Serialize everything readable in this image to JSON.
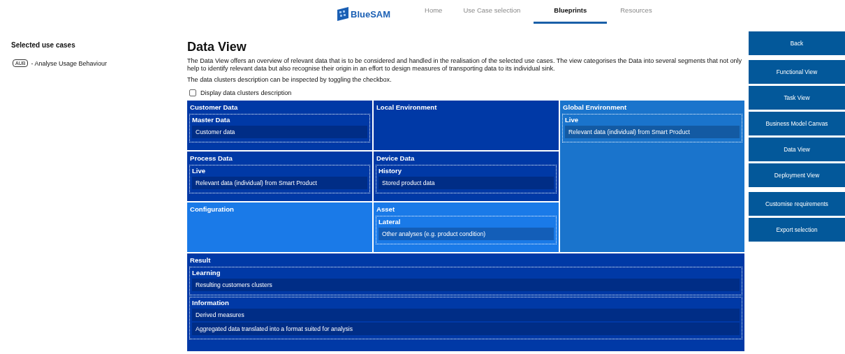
{
  "nav": {
    "logo": "BlueSAM",
    "tabs": [
      {
        "label": "Home",
        "selected": false
      },
      {
        "label": "Use Case selection",
        "selected": false
      },
      {
        "label": "Blueprints",
        "selected": true
      },
      {
        "label": "Resources",
        "selected": false
      }
    ]
  },
  "sidebar": {
    "title": "Selected use cases",
    "items": [
      {
        "badge": "AUB",
        "label": "- Analyse Usage Behaviour"
      }
    ]
  },
  "main": {
    "title": "Data View",
    "description": "The Data View offers an overview of relevant data that is to be considered and handled in the realisation of the selected use cases. The view categorises the Data into several segments that not only help to identify relevant data but also recognise their origin in an effort to design measures of transporting data to its individual sink.",
    "hint": "The data clusters description can be inspected by toggling the checkbox.",
    "checkbox": {
      "label": "Display data clusters description",
      "checked": false
    },
    "clusters": [
      {
        "title": "Customer Data",
        "kind": "cell",
        "color": "#0039a6",
        "groups": [
          {
            "title": "Master Data",
            "items": [
              "Customer data"
            ]
          }
        ]
      },
      {
        "title": "Local Environment",
        "kind": "cell",
        "color": "#0039a6"
      },
      {
        "title": "Global Environment",
        "kind": "tall",
        "color": "#1a74cc",
        "groups": [
          {
            "title": "Live",
            "items": [
              "Relevant data (individual) from Smart Product"
            ]
          }
        ]
      },
      {
        "title": "Process Data",
        "kind": "cell",
        "color": "#0039a6",
        "groups": [
          {
            "title": "Live",
            "items": [
              "Relevant data (individual) from Smart Product"
            ]
          }
        ]
      },
      {
        "title": "Device Data",
        "kind": "cell",
        "color": "#0039a6",
        "groups": [
          {
            "title": "History",
            "items": [
              "Stored product data"
            ]
          }
        ]
      },
      {
        "title": "Configuration",
        "kind": "cell",
        "color": "#1a7ae8"
      },
      {
        "title": "Asset",
        "kind": "cell",
        "color": "#1a7ae8",
        "groups": [
          {
            "title": "Lateral",
            "items": [
              "Other analyses (e.g. product condition)"
            ]
          }
        ]
      },
      {
        "title": "Result",
        "kind": "wide",
        "color": "#0039a6",
        "groups": [
          {
            "title": "Learning",
            "items": [
              "Resulting customers clusters"
            ]
          },
          {
            "title": "Information",
            "items": [
              "Derived measures",
              "Aggregated data translated into a format suited for analysis"
            ]
          }
        ]
      }
    ]
  },
  "actions": [
    [
      "Back"
    ],
    [
      "Functional View",
      "Task View",
      "Business Model Canvas",
      "Data View",
      "Deployment View"
    ],
    [
      "Customise requirements",
      "Export selection"
    ]
  ]
}
